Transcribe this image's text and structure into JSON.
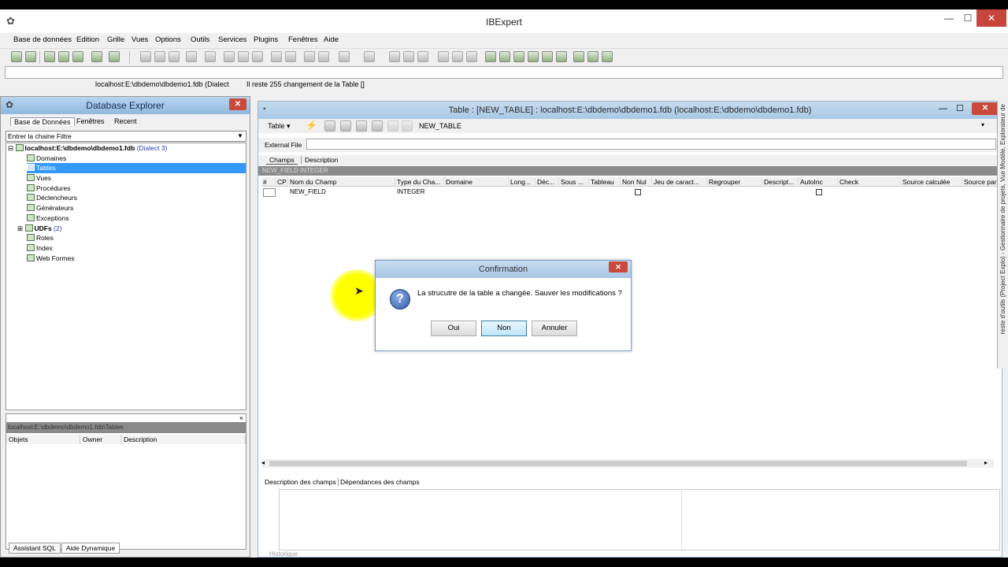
{
  "app": {
    "title": "IBExpert"
  },
  "menu": [
    "Base de données",
    "Edition",
    "Grille",
    "Vues",
    "Options",
    "Outils",
    "Services",
    "Plugins",
    "Fenêtres",
    "Aide"
  ],
  "status": {
    "connection": "localhost:E:\\dbdemo\\dbdemo1.fdb (Dialect",
    "message": "Il reste 255 changement de la Table []"
  },
  "db_explorer": {
    "title": "Database Explorer",
    "tabs": [
      "Base de Données",
      "Fenêtres",
      "Recent"
    ],
    "filter_placeholder": "Entrer la chaine Filtre",
    "tree": {
      "root": "localhost:E:\\dbdemo\\dbdemo1.fdb",
      "root_dialect": "(Dialect 3)",
      "items": [
        "Domaines",
        "Tables",
        "Vues",
        "Procédures",
        "Déclencheurs",
        "Générateurs",
        "Exceptions",
        "UDFs",
        "Roles",
        "Index",
        "Web Formes"
      ],
      "udf_count": "(2)"
    },
    "lower_path": "localhost:E:\\dbdemo\\dbdemo1.fdb\\Tables",
    "lower_columns": [
      "Objets",
      "Owner",
      "Description"
    ],
    "bottom_tabs": [
      "Assistant SQL",
      "Aide Dynamique"
    ]
  },
  "editor": {
    "title": "Table : [NEW_TABLE] : localhost:E:\\dbdemo\\dbdemo1.fdb (localhost:E:\\dbdemo\\dbdemo1.fdb)",
    "table_menu": "Table",
    "table_name": "NEW_TABLE",
    "external_file_label": "External File",
    "tabs": [
      "Champs",
      "Description"
    ],
    "strip": "NEW_FIELD INTEGER",
    "columns": [
      "#",
      "CP",
      "Nom du Champ",
      "Type du Cha...",
      "Domaine",
      "Long...",
      "Déc...",
      "Sous ...",
      "Tableau",
      "Non Nul",
      "Jeu de caract...",
      "Regrouper",
      "Descript...",
      "AutoInc",
      "Check",
      "Source calculée",
      "Source par"
    ],
    "row": {
      "name": "NEW_FIELD",
      "type": "INTEGER"
    },
    "bottom_tabs": [
      "Description des champs",
      "Dépendances des champs"
    ],
    "history": "Historique"
  },
  "dialog": {
    "title": "Confirmation",
    "message": "La strucutre de la table a changée. Sauver les modifications ?",
    "buttons": {
      "yes": "Oui",
      "no": "Non",
      "cancel": "Annuler"
    }
  },
  "right_dock": "reste d'outils (Project Explo) - Gestionnaire de projets, Vue Modèle, Explorateur de"
}
